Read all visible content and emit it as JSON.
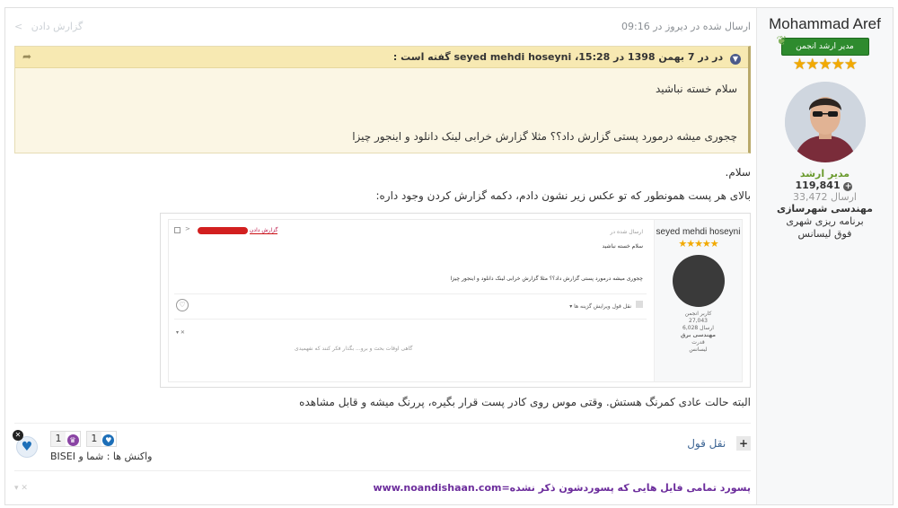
{
  "author": {
    "name": "Mohammad Aref",
    "rank_badge": "مدیر ارشد انجمن",
    "stars": "★★★★★",
    "group": "مدیر ارشد",
    "reputation": "119,841",
    "posts_count": "33,472",
    "posts_label": "ارسال",
    "field_1": "مهندسی شهرسازی",
    "field_2": "برنامه ریزی شهری",
    "field_3": "فوق لیسانس"
  },
  "post": {
    "meta": "ارسال شده در دیروز در 09:16",
    "report_label": "گزارش دادن",
    "quote": {
      "header": "در در 7 بهمن 1398 در 15:28، seyed mehdi hoseyni گفته است :",
      "line1": "سلام خسته نباشید",
      "line2": "چجوری میشه درمورد پستی گزارش داد؟؟ مثلا گزارش خرابی لینک دانلود و اینجور چیزا"
    },
    "line1": "سلام.",
    "line2": "بالای هر پست همونطور که تو عکس زیر نشون دادم، دکمه گزارش کردن وجود داره:",
    "line3": "البته حالت عادی کمرنگ هستش. وقتی موس روی کادر پست قرار بگیره، پررنگ میشه و قابل مشاهده"
  },
  "screenshot": {
    "author_name": "seyed mehdi hoseyni",
    "stars": "★★★★★",
    "group": "کاربر انجمن",
    "reputation": "27,043",
    "posts": "6,028",
    "posts_label": "ارسال",
    "field_1": "مهندسی برق",
    "field_2": "قدرت",
    "field_3": "لیسانس",
    "meta": "ارسال شده در",
    "report": "گزارش دادن",
    "line1": "سلام خسته نباشید",
    "line2": "چجوری میشه درمورد پستی گزارش داد؟؟ مثلا گزارش خرابی لینک دانلود و اینجور چیزا",
    "actions": "نقل قول    ویرایش    گزینه ها ▾",
    "note": "گاهی اوقات بحث و برو... بگذار فکر کنند که نفهمیدی"
  },
  "actions": {
    "quote_label": "نقل قول",
    "plus": "+"
  },
  "reactions": {
    "like_count": "1",
    "trophy_count": "1",
    "by_text": "واکنش ها : شما و BISEI"
  },
  "signature": {
    "text": "پسورد تمامی فایل هایی که پسوردشون ذکر نشده=www.noandishaan.com"
  },
  "colors": {
    "quote_bg": "#fbf6e4",
    "quote_header_bg": "#f7e9b2",
    "badge_green": "#2e8b2e",
    "star_gold": "#f2a900",
    "signature_purple": "#6c2d9c",
    "link_blue": "#3d6594"
  }
}
